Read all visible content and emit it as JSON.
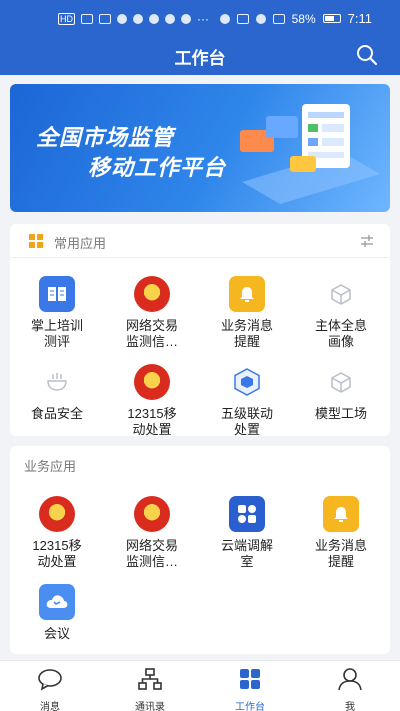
{
  "status_bar": {
    "signal_text": "HD",
    "battery_percent": "58%",
    "time": "7:11"
  },
  "header": {
    "title": "工作台"
  },
  "banner": {
    "line1": "全国市场监管",
    "line2": "移动工作平台"
  },
  "common_apps": {
    "title": "常用应用",
    "items": [
      {
        "label": "掌上培训\n测评",
        "icon": "book-icon"
      },
      {
        "label": "网络交易\n监测信…",
        "icon": "national-emblem-icon"
      },
      {
        "label": "业务消息\n提醒",
        "icon": "bell-icon"
      },
      {
        "label": "主体全息\n画像",
        "icon": "cube-icon"
      },
      {
        "label": "食品安全",
        "icon": "food-bowl-icon"
      },
      {
        "label": "12315移\n动处置",
        "icon": "national-emblem-icon"
      },
      {
        "label": "五级联动\n处置",
        "icon": "hexagon-cube-icon"
      },
      {
        "label": "模型工场",
        "icon": "cube-icon"
      }
    ]
  },
  "business_apps": {
    "title": "业务应用",
    "items": [
      {
        "label": "12315移\n动处置",
        "icon": "national-emblem-icon"
      },
      {
        "label": "网络交易\n监测信…",
        "icon": "national-emblem-icon"
      },
      {
        "label": "云端调解\n室",
        "icon": "dots-grid-icon"
      },
      {
        "label": "业务消息\n提醒",
        "icon": "bell-icon"
      },
      {
        "label": "会议",
        "icon": "phone-cloud-icon"
      }
    ]
  },
  "bottom_nav": {
    "items": [
      {
        "label": "消息"
      },
      {
        "label": "通讯录"
      },
      {
        "label": "工作台"
      },
      {
        "label": "我"
      }
    ],
    "active_label": "工作台"
  },
  "colors": {
    "primary": "#2b66cf",
    "accent_gold": "#f5b61f"
  }
}
